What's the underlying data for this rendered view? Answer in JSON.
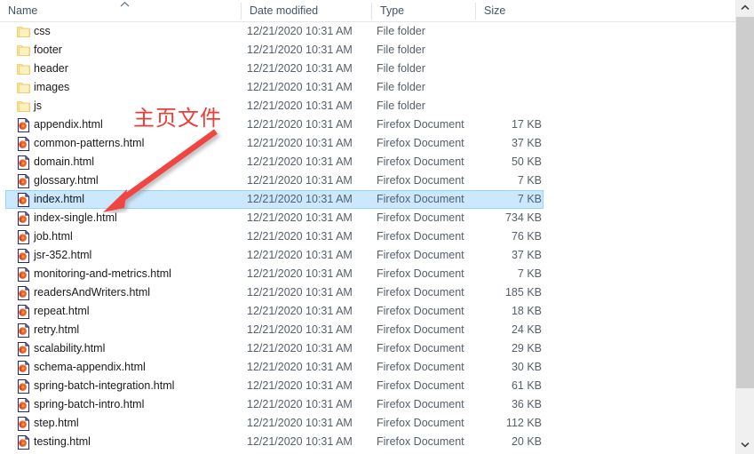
{
  "window": {
    "kind": "file-explorer-list-view"
  },
  "columns": [
    {
      "key": "name",
      "label": "Name",
      "sorted": true,
      "sort_direction": "ascending",
      "sort_icon": "chevron-up-icon"
    },
    {
      "key": "date_modified",
      "label": "Date modified"
    },
    {
      "key": "type",
      "label": "Type"
    },
    {
      "key": "size",
      "label": "Size"
    }
  ],
  "rows": [
    {
      "name": "css",
      "date": "12/21/2020 10:31 AM",
      "type": "File folder",
      "size": "",
      "icon": "folder-icon",
      "selected": false
    },
    {
      "name": "footer",
      "date": "12/21/2020 10:31 AM",
      "type": "File folder",
      "size": "",
      "icon": "folder-icon",
      "selected": false
    },
    {
      "name": "header",
      "date": "12/21/2020 10:31 AM",
      "type": "File folder",
      "size": "",
      "icon": "folder-icon",
      "selected": false
    },
    {
      "name": "images",
      "date": "12/21/2020 10:31 AM",
      "type": "File folder",
      "size": "",
      "icon": "folder-icon",
      "selected": false
    },
    {
      "name": "js",
      "date": "12/21/2020 10:31 AM",
      "type": "File folder",
      "size": "",
      "icon": "folder-icon",
      "selected": false
    },
    {
      "name": "appendix.html",
      "date": "12/21/2020 10:31 AM",
      "type": "Firefox Document",
      "size": "17 KB",
      "icon": "firefox-document-icon",
      "selected": false
    },
    {
      "name": "common-patterns.html",
      "date": "12/21/2020 10:31 AM",
      "type": "Firefox Document",
      "size": "37 KB",
      "icon": "firefox-document-icon",
      "selected": false
    },
    {
      "name": "domain.html",
      "date": "12/21/2020 10:31 AM",
      "type": "Firefox Document",
      "size": "50 KB",
      "icon": "firefox-document-icon",
      "selected": false
    },
    {
      "name": "glossary.html",
      "date": "12/21/2020 10:31 AM",
      "type": "Firefox Document",
      "size": "7 KB",
      "icon": "firefox-document-icon",
      "selected": false
    },
    {
      "name": "index.html",
      "date": "12/21/2020 10:31 AM",
      "type": "Firefox Document",
      "size": "7 KB",
      "icon": "firefox-document-icon",
      "selected": true
    },
    {
      "name": "index-single.html",
      "date": "12/21/2020 10:31 AM",
      "type": "Firefox Document",
      "size": "734 KB",
      "icon": "firefox-document-icon",
      "selected": false
    },
    {
      "name": "job.html",
      "date": "12/21/2020 10:31 AM",
      "type": "Firefox Document",
      "size": "76 KB",
      "icon": "firefox-document-icon",
      "selected": false
    },
    {
      "name": "jsr-352.html",
      "date": "12/21/2020 10:31 AM",
      "type": "Firefox Document",
      "size": "37 KB",
      "icon": "firefox-document-icon",
      "selected": false
    },
    {
      "name": "monitoring-and-metrics.html",
      "date": "12/21/2020 10:31 AM",
      "type": "Firefox Document",
      "size": "7 KB",
      "icon": "firefox-document-icon",
      "selected": false
    },
    {
      "name": "readersAndWriters.html",
      "date": "12/21/2020 10:31 AM",
      "type": "Firefox Document",
      "size": "185 KB",
      "icon": "firefox-document-icon",
      "selected": false
    },
    {
      "name": "repeat.html",
      "date": "12/21/2020 10:31 AM",
      "type": "Firefox Document",
      "size": "18 KB",
      "icon": "firefox-document-icon",
      "selected": false
    },
    {
      "name": "retry.html",
      "date": "12/21/2020 10:31 AM",
      "type": "Firefox Document",
      "size": "24 KB",
      "icon": "firefox-document-icon",
      "selected": false
    },
    {
      "name": "scalability.html",
      "date": "12/21/2020 10:31 AM",
      "type": "Firefox Document",
      "size": "29 KB",
      "icon": "firefox-document-icon",
      "selected": false
    },
    {
      "name": "schema-appendix.html",
      "date": "12/21/2020 10:31 AM",
      "type": "Firefox Document",
      "size": "30 KB",
      "icon": "firefox-document-icon",
      "selected": false
    },
    {
      "name": "spring-batch-integration.html",
      "date": "12/21/2020 10:31 AM",
      "type": "Firefox Document",
      "size": "61 KB",
      "icon": "firefox-document-icon",
      "selected": false
    },
    {
      "name": "spring-batch-intro.html",
      "date": "12/21/2020 10:31 AM",
      "type": "Firefox Document",
      "size": "36 KB",
      "icon": "firefox-document-icon",
      "selected": false
    },
    {
      "name": "step.html",
      "date": "12/21/2020 10:31 AM",
      "type": "Firefox Document",
      "size": "112 KB",
      "icon": "firefox-document-icon",
      "selected": false
    },
    {
      "name": "testing.html",
      "date": "12/21/2020 10:31 AM",
      "type": "Firefox Document",
      "size": "20 KB",
      "icon": "firefox-document-icon",
      "selected": false
    }
  ],
  "annotation": {
    "text": "主页文件",
    "color": "#f03b36",
    "arrow": "red-arrow-pointing-to-index-html"
  },
  "scrollbar": {
    "up_icon": "chevron-up-icon",
    "down_icon": "chevron-down-icon",
    "orientation": "vertical"
  },
  "colors": {
    "selection_fill": "#cce8ff",
    "selection_border": "#99d1ff",
    "header_text": "#44546a",
    "row_text": "#1a1a1a",
    "meta_text": "#55606b",
    "folder_icon": "#fde79a",
    "annotation_red": "#f03b36",
    "scrollbar_thumb": "#cdcdcd"
  }
}
